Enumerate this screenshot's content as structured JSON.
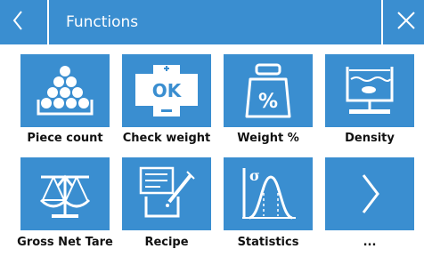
{
  "header": {
    "title": "Functions",
    "back_icon": "chevron-left-icon",
    "close_icon": "close-icon"
  },
  "tiles": [
    {
      "label": "Piece count",
      "icon": "piece-count-icon"
    },
    {
      "label": "Check weight",
      "icon": "check-weight-icon"
    },
    {
      "label": "Weight %",
      "icon": "weight-percent-icon"
    },
    {
      "label": "Density",
      "icon": "density-icon"
    },
    {
      "label": "Gross Net Tare",
      "icon": "gross-net-tare-icon"
    },
    {
      "label": "Recipe",
      "icon": "recipe-icon"
    },
    {
      "label": "Statistics",
      "icon": "statistics-icon"
    },
    {
      "label": "...",
      "icon": "chevron-right-icon"
    }
  ],
  "colors": {
    "accent": "#3a8ed0",
    "icon": "#ffffff",
    "label": "#111111"
  }
}
